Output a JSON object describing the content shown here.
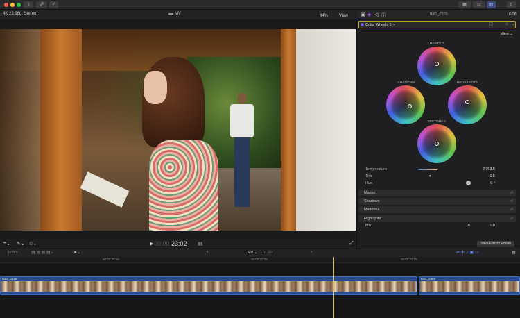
{
  "titlebar": {
    "buttons": [
      "⇓",
      "🗝",
      "✓"
    ]
  },
  "viewer": {
    "format": "4K 23.98p, Stereo",
    "project": "MV",
    "zoom": "64%",
    "view_label": "View",
    "timecode_dim": "00:00",
    "timecode": "23:02"
  },
  "inspector": {
    "clip_name": "IMG_0339",
    "clip_time": "6:08",
    "effect_name": "Color Wheels 1",
    "view_label": "View",
    "wheels": {
      "master": "MASTER",
      "shadows": "SHADOWS",
      "highlights": "HIGHLIGHTS",
      "midtones": "MIDTONES"
    },
    "params": [
      {
        "label": "Temperature",
        "value": "5753.5"
      },
      {
        "label": "Tint",
        "value": "-1.5"
      },
      {
        "label": "Hue",
        "value": "0 °"
      }
    ],
    "sections": [
      "Master",
      "Shadows",
      "Midtones",
      "Highlights"
    ],
    "mix": {
      "label": "Mix",
      "value": "1.0"
    },
    "save_preset": "Save Effects Preset"
  },
  "timeline": {
    "index_label": "Index",
    "project": "MV",
    "duration": "01:20",
    "ruler": [
      "00:00:20:00",
      "00:00:22:00",
      "00:00:24:00"
    ],
    "clips": [
      {
        "name": "IMG_0339"
      },
      {
        "name": "IMG_0369"
      }
    ]
  },
  "colors": {
    "accent": "#c8a02a",
    "clip": "#2a4a8a",
    "playhead": "#e0c040"
  }
}
